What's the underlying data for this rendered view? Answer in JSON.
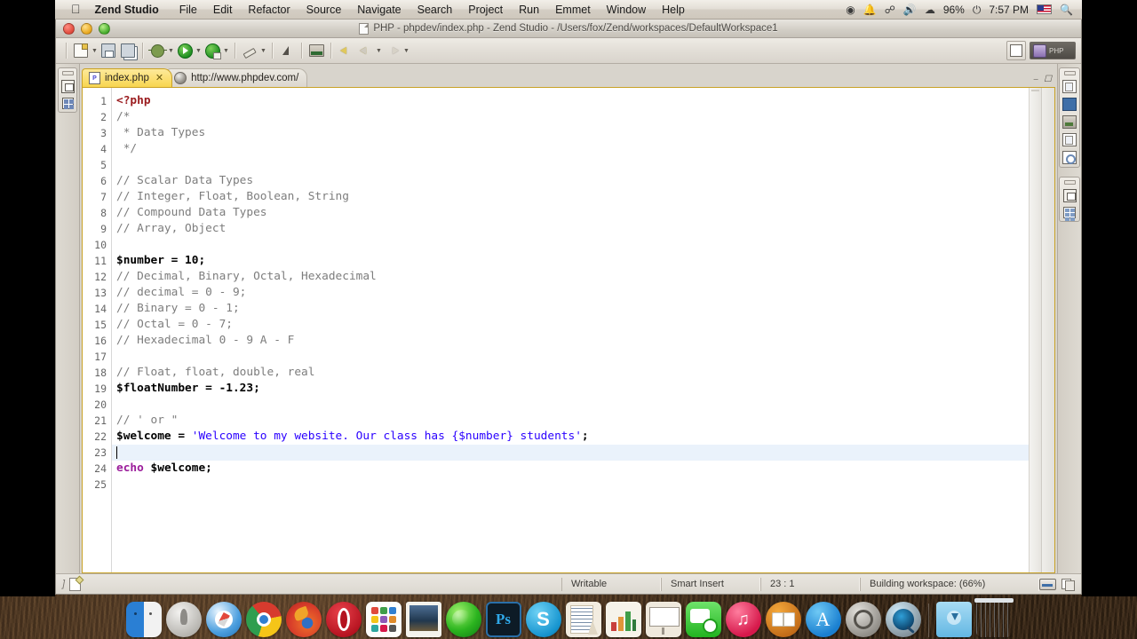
{
  "menubar": {
    "apple_icon": "apple-icon",
    "app_name": "Zend Studio",
    "items": [
      "File",
      "Edit",
      "Refactor",
      "Source",
      "Navigate",
      "Search",
      "Project",
      "Run",
      "Emmet",
      "Window",
      "Help"
    ],
    "status_icons": [
      "screen-record-icon",
      "notification-bell-icon",
      "bluetooth-icon",
      "volume-icon",
      "wifi-icon"
    ],
    "battery": "96%",
    "time": "7:57 PM",
    "flag": "us-flag-icon",
    "search_icon": "search-icon"
  },
  "window": {
    "title": "PHP - phpdev/index.php - Zend Studio - /Users/fox/Zend/workspaces/DefaultWorkspace1",
    "traffic_lights": [
      "close",
      "minimize",
      "zoom"
    ]
  },
  "toolbar": {
    "buttons": [
      {
        "name": "new-file-button",
        "label": "New"
      },
      {
        "name": "save-button",
        "label": "Save"
      },
      {
        "name": "save-all-button",
        "label": "Save All"
      },
      {
        "name": "debug-button",
        "label": "Debug"
      },
      {
        "name": "run-button",
        "label": "Run"
      },
      {
        "name": "profile-button",
        "label": "Profile"
      },
      {
        "name": "external-tools-button",
        "label": "External Tools"
      },
      {
        "name": "marker-button",
        "label": "Marker"
      },
      {
        "name": "open-task-button",
        "label": "Open Task"
      },
      {
        "name": "back-button",
        "label": "Back"
      },
      {
        "name": "previous-button",
        "label": "Previous"
      },
      {
        "name": "forward-button",
        "label": "Forward"
      }
    ],
    "perspective_open_label": "Open Perspective",
    "perspective_active_label": "PHP"
  },
  "tabs": [
    {
      "label": "index.php",
      "icon": "php-file-icon",
      "active": true,
      "close": "✕"
    },
    {
      "label": "http://www.phpdev.com/",
      "icon": "web-browser-icon",
      "active": false
    }
  ],
  "editor": {
    "cursor_position": "23 : 1",
    "lines": [
      {
        "n": "1",
        "tokens": [
          {
            "t": "<?php",
            "c": "tagphp"
          }
        ]
      },
      {
        "n": "2",
        "tokens": [
          {
            "t": "/*",
            "c": "cmt"
          }
        ]
      },
      {
        "n": "3",
        "tokens": [
          {
            "t": " * Data Types",
            "c": "cmt"
          }
        ]
      },
      {
        "n": "4",
        "tokens": [
          {
            "t": " */",
            "c": "cmt"
          }
        ]
      },
      {
        "n": "5",
        "tokens": []
      },
      {
        "n": "6",
        "tokens": [
          {
            "t": "// Scalar Data Types",
            "c": "cmt"
          }
        ]
      },
      {
        "n": "7",
        "tokens": [
          {
            "t": "// Integer, Float, Boolean, String",
            "c": "cmt"
          }
        ]
      },
      {
        "n": "8",
        "tokens": [
          {
            "t": "// Compound Data Types",
            "c": "cmt"
          }
        ]
      },
      {
        "n": "9",
        "tokens": [
          {
            "t": "// Array, Object",
            "c": "cmt"
          }
        ]
      },
      {
        "n": "10",
        "tokens": []
      },
      {
        "n": "11",
        "tokens": [
          {
            "t": "$number = 10;",
            "c": "code"
          }
        ]
      },
      {
        "n": "12",
        "tokens": [
          {
            "t": "// Decimal, Binary, Octal, Hexadecimal",
            "c": "cmt"
          }
        ]
      },
      {
        "n": "13",
        "tokens": [
          {
            "t": "// decimal = 0 - 9;",
            "c": "cmt"
          }
        ]
      },
      {
        "n": "14",
        "tokens": [
          {
            "t": "// Binary = 0 - 1;",
            "c": "cmt"
          }
        ]
      },
      {
        "n": "15",
        "tokens": [
          {
            "t": "// Octal = 0 - 7;",
            "c": "cmt"
          }
        ]
      },
      {
        "n": "16",
        "tokens": [
          {
            "t": "// Hexadecimal 0 - 9 A - F",
            "c": "cmt"
          }
        ]
      },
      {
        "n": "17",
        "tokens": []
      },
      {
        "n": "18",
        "tokens": [
          {
            "t": "// Float, float, double, real",
            "c": "cmt"
          }
        ]
      },
      {
        "n": "19",
        "tokens": [
          {
            "t": "$floatNumber = -1.23;",
            "c": "code"
          }
        ]
      },
      {
        "n": "20",
        "tokens": []
      },
      {
        "n": "21",
        "tokens": [
          {
            "t": "// ' or \"",
            "c": "cmt"
          }
        ]
      },
      {
        "n": "22",
        "tokens": [
          {
            "t": "$welcome = ",
            "c": "code"
          },
          {
            "t": "'Welcome to my website. Our class has {$number} students'",
            "c": "str"
          },
          {
            "t": ";",
            "c": "code"
          }
        ]
      },
      {
        "n": "23",
        "tokens": [],
        "cursor": true
      },
      {
        "n": "24",
        "tokens": [
          {
            "t": "echo",
            "c": "kw"
          },
          {
            "t": " $welcome;",
            "c": "code"
          }
        ]
      },
      {
        "n": "25",
        "tokens": []
      }
    ]
  },
  "left_view_bar": {
    "icons": [
      "restore-view-icon",
      "outline-view-icon"
    ]
  },
  "right_view_bar": {
    "icons": [
      "php-explorer-icon",
      "browser-view-icon",
      "servers-view-icon",
      "tasks-view-icon",
      "properties-view-icon",
      "restore-view-icon",
      "outline-view-icon"
    ]
  },
  "statusbar": {
    "writable": "Writable",
    "insert_mode": "Smart Insert",
    "position": "23 : 1",
    "progress": "Building workspace: (66%)",
    "right_icons": [
      "keyboard-icon",
      "pages-icon"
    ]
  },
  "dock": {
    "items": [
      {
        "name": "dock-finder",
        "label": "Finder",
        "cls": "d-finder",
        "running": true
      },
      {
        "name": "dock-launchpad",
        "label": "Launchpad",
        "cls": "d-launch",
        "running": false
      },
      {
        "name": "dock-safari",
        "label": "Safari",
        "cls": "d-safari",
        "running": false
      },
      {
        "name": "dock-chrome",
        "label": "Google Chrome",
        "cls": "d-chrome",
        "running": true
      },
      {
        "name": "dock-firefox",
        "label": "Firefox",
        "cls": "d-ff",
        "running": false
      },
      {
        "name": "dock-opera",
        "label": "Opera",
        "cls": "d-opera",
        "running": false
      },
      {
        "name": "dock-app-grid",
        "label": "Applications",
        "cls": "d-grid",
        "running": false
      },
      {
        "name": "dock-photos",
        "label": "Photos",
        "cls": "d-photo",
        "running": false
      },
      {
        "name": "dock-zend-studio",
        "label": "Zend Studio",
        "cls": "d-zend",
        "running": true
      },
      {
        "name": "dock-photoshop",
        "label": "Ps",
        "cls": "d-ps",
        "running": false
      },
      {
        "name": "dock-skype",
        "label": "S",
        "cls": "d-skype",
        "running": false
      },
      {
        "name": "dock-pages",
        "label": "Pages",
        "cls": "d-pages",
        "running": false
      },
      {
        "name": "dock-numbers",
        "label": "Numbers",
        "cls": "d-numbers",
        "running": false
      },
      {
        "name": "dock-keynote",
        "label": "Keynote",
        "cls": "d-keynote",
        "running": false
      },
      {
        "name": "dock-messages",
        "label": "Messages",
        "cls": "d-msg",
        "running": false
      },
      {
        "name": "dock-itunes",
        "label": "♫",
        "cls": "d-itunes",
        "running": false
      },
      {
        "name": "dock-ibooks",
        "label": "iBooks",
        "cls": "d-ibooks",
        "running": false
      },
      {
        "name": "dock-app-store",
        "label": "A",
        "cls": "d-appstore",
        "running": false
      },
      {
        "name": "dock-system-preferences",
        "label": "System Preferences",
        "cls": "d-sysprefs",
        "running": false
      },
      {
        "name": "dock-quicktime",
        "label": "QuickTime",
        "cls": "d-qt",
        "running": false
      },
      {
        "name": "dock-downloads-folder",
        "label": "Downloads",
        "cls": "d-folder",
        "running": false
      },
      {
        "name": "dock-trash",
        "label": "Trash",
        "cls": "d-trash",
        "running": false
      }
    ]
  },
  "colors": {
    "tab_active": "#fbdf72",
    "tab_border": "#c9a227",
    "comment": "#7d7d7d",
    "string": "#2a00ff",
    "keyword": "#9b1d9b",
    "php_tag": "#9b1d20",
    "cursor_line": "#eaf2fb"
  }
}
